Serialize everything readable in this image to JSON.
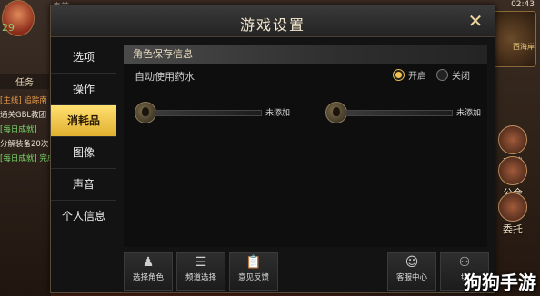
{
  "hud": {
    "top_name": "奏首",
    "level": "29",
    "task_tab": "任务",
    "quests": [
      {
        "text": "[主线] 追踪南",
        "color": "orange"
      },
      {
        "text": "通关GBL教团",
        "color": "white"
      },
      {
        "text": "[每日成就]",
        "color": "green"
      },
      {
        "text": "分解装备20次",
        "color": "white"
      },
      {
        "text": "[每日成就] 完成",
        "color": "green"
      }
    ],
    "time": "02:43",
    "minimap_label": "西海岸",
    "side_buttons": [
      {
        "label": "对战"
      },
      {
        "label": "公会"
      },
      {
        "label": "委托"
      }
    ]
  },
  "dialog": {
    "title": "游戏设置",
    "close_symbol": "✕",
    "tabs": [
      {
        "label": "选项"
      },
      {
        "label": "操作"
      },
      {
        "label": "消耗品"
      },
      {
        "label": "图像"
      },
      {
        "label": "声音"
      },
      {
        "label": "个人信息"
      }
    ],
    "active_tab": "消耗品",
    "section_title": "角色保存信息",
    "auto_potion": {
      "label": "自动使用药水",
      "options": [
        {
          "label": "开启",
          "selected": true
        },
        {
          "label": "关闭",
          "selected": false
        }
      ]
    },
    "slots": [
      {
        "text": "未添加"
      },
      {
        "text": "未添加"
      }
    ],
    "bottom_buttons": [
      {
        "icon": "person-icon",
        "glyph": "♟",
        "label": "选择角色"
      },
      {
        "icon": "list-icon",
        "glyph": "☰",
        "label": "频道选择"
      },
      {
        "icon": "clipboard-icon",
        "glyph": "📋",
        "label": "意见反馈"
      },
      {
        "icon": "headset-icon",
        "glyph": "☺",
        "label": "客服中心"
      },
      {
        "icon": "switch-icon",
        "glyph": "⚇",
        "label": "切"
      }
    ]
  },
  "watermark": "狗狗手游",
  "colors": {
    "accent_tab": "#f0c040",
    "radio_selected": "#f0c050",
    "dialog_bg": "#131313"
  }
}
